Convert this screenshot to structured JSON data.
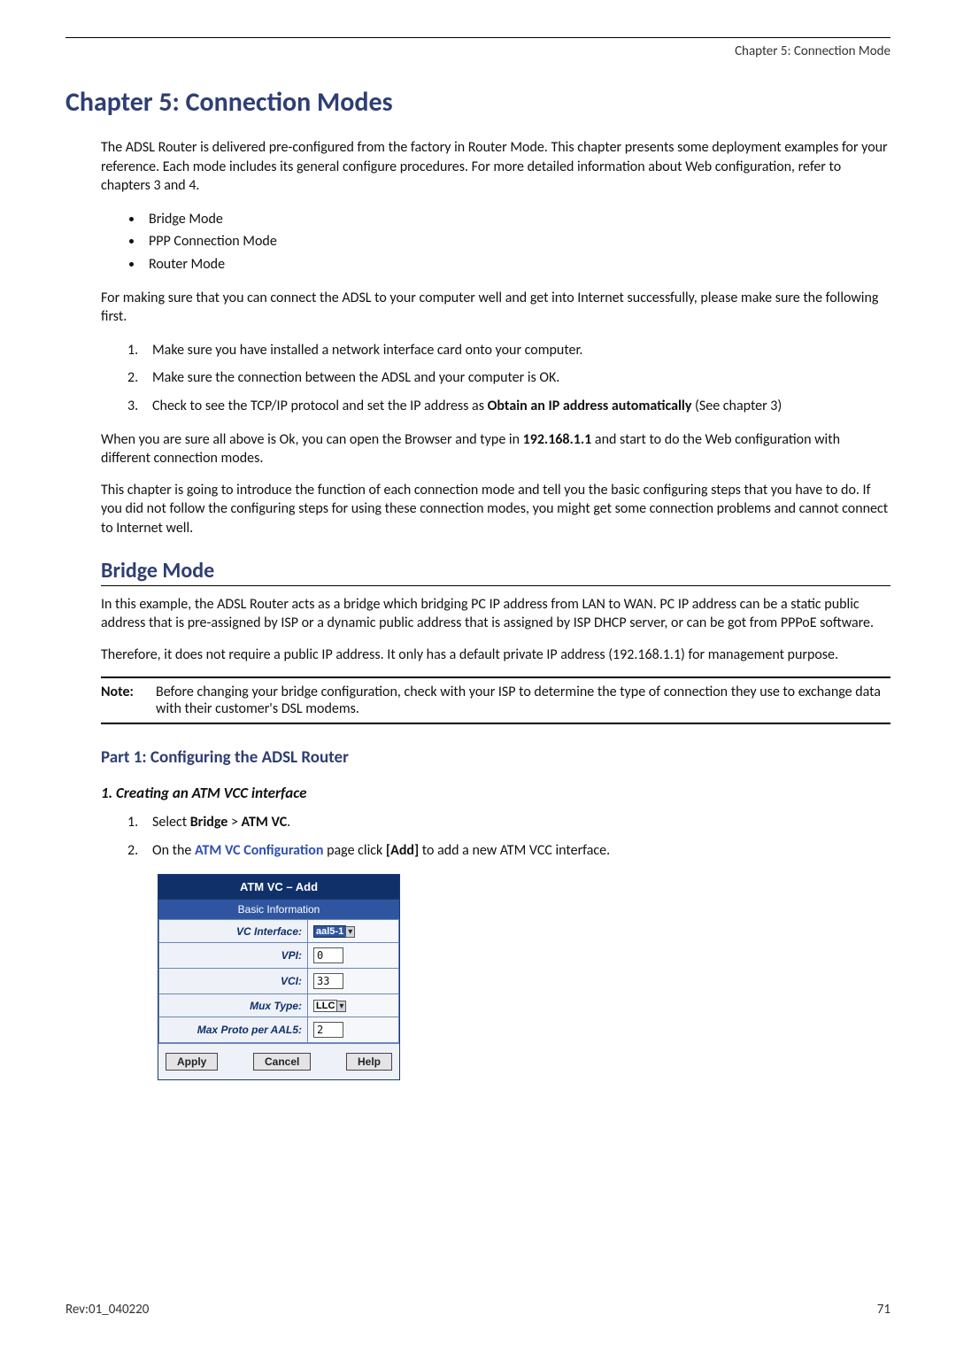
{
  "header": {
    "running_title": "Chapter 5: Connection Mode"
  },
  "chapter": {
    "title": "Chapter 5: Connection Modes"
  },
  "intro": {
    "p1": "The ADSL Router is delivered pre-configured from the factory in Router Mode. This chapter presents some deployment examples for your reference. Each mode includes its general configure procedures. For more detailed information about Web configuration, refer to chapters 3 and 4.",
    "bullets": [
      "Bridge Mode",
      "PPP Connection Mode",
      "Router Mode"
    ],
    "p2": "For making sure that you can connect the ADSL to your computer well and get into Internet successfully, please make sure the following first.",
    "numbered": [
      "Make sure you have installed a network interface card onto your computer.",
      "Make sure the connection between the ADSL and your computer is OK.",
      "Check to see the TCP/IP protocol and set the IP address as Obtain an IP address automatically (See chapter 3)"
    ],
    "num3_prefix": "Check to see the TCP/IP protocol and set the IP address as ",
    "num3_bold": "Obtain an IP address automatically",
    "num3_suffix": " (See chapter 3)",
    "p3_prefix": "When you are sure all above is Ok, you can open the Browser and type in ",
    "p3_bold": "192.168.1.1",
    "p3_suffix": " and start to do the Web configuration with different connection modes.",
    "p4": "This chapter is going to introduce the function of each connection mode and tell you the basic configuring steps that you have to do. If you did not follow the configuring steps for using these connection modes, you might get some connection problems and cannot connect to Internet well."
  },
  "bridge": {
    "title": "Bridge Mode",
    "p1": "In this example, the ADSL Router acts as a bridge which bridging PC IP address from LAN to WAN. PC IP address can be a static public address that is pre-assigned by ISP or a dynamic public address that is assigned by ISP DHCP server, or can be got from PPPoE software.",
    "p2": "Therefore, it does not require a public IP address. It only has a default private IP address (192.168.1.1) for management purpose.",
    "note_label": "Note:",
    "note_text": "Before changing your bridge configuration, check with your ISP to determine the type of connection they use to exchange data with their customer's DSL modems."
  },
  "part1": {
    "title": "Part 1: Configuring the ADSL Router",
    "step_title": "1. Creating an ATM VCC interface",
    "step1_prefix": "Select ",
    "step1_b1": "Bridge",
    "step1_mid": " > ",
    "step1_b2": "ATM VC",
    "step1_suffix": ".",
    "step2_prefix": "On the ",
    "step2_link": "ATM VC Configuration",
    "step2_mid": " page click ",
    "step2_bold": "[Add]",
    "step2_suffix": " to add a new ATM VCC interface."
  },
  "dialog": {
    "title": "ATM VC – Add",
    "section": "Basic Information",
    "rows": {
      "vc_interface_label": "VC Interface:",
      "vc_interface_value": "aal5-1",
      "vpi_label": "VPI:",
      "vpi_value": "0",
      "vci_label": "VCI:",
      "vci_value": "33",
      "mux_label": "Mux Type:",
      "mux_value": "LLC",
      "maxproto_label": "Max Proto per AAL5:",
      "maxproto_value": "2"
    },
    "buttons": {
      "apply": "Apply",
      "cancel": "Cancel",
      "help": "Help"
    }
  },
  "footer": {
    "rev": "Rev:01_040220",
    "page": "71"
  }
}
